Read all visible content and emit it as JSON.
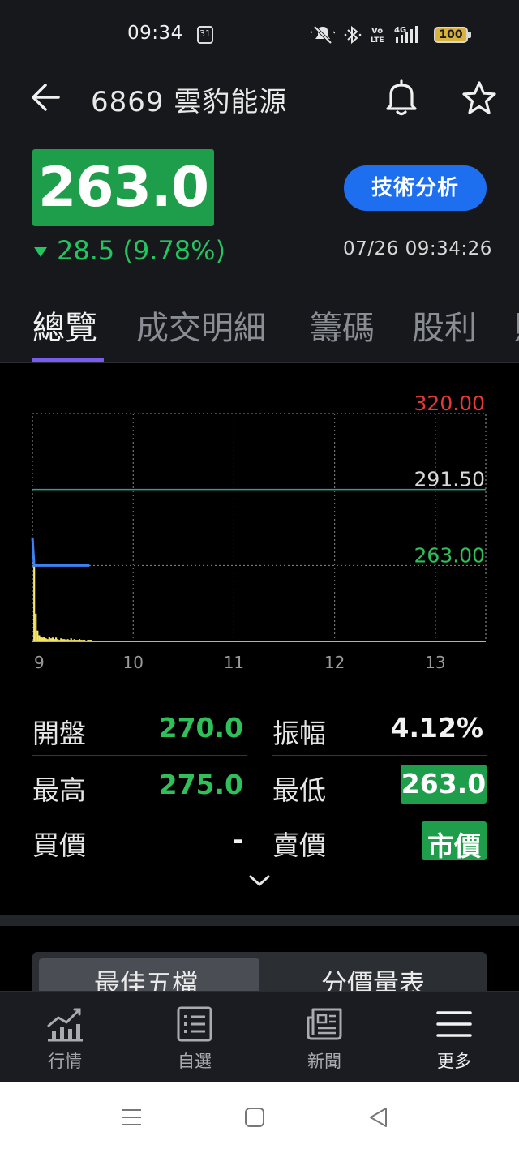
{
  "status_bar": {
    "time": "09:34",
    "calendar_day": "31",
    "battery": "100",
    "icons": [
      "mute-icon",
      "bluetooth-icon",
      "volte-icon",
      "signal-4g-icon",
      "battery-icon"
    ]
  },
  "header": {
    "title": "6869 雲豹能源",
    "icons": [
      "back-arrow-icon",
      "bell-icon",
      "star-icon"
    ]
  },
  "quote": {
    "price": "263.0",
    "change": "28.5 (9.78%)",
    "direction": "down",
    "timestamp": "07/26 09:34:26",
    "tech_button_label": "技術分析",
    "colors": {
      "down": "#22c55e",
      "up": "#e53935",
      "accent": "#1d6ff0"
    }
  },
  "tabs": [
    {
      "label": "總覽",
      "active": true
    },
    {
      "label": "成交明細",
      "active": false
    },
    {
      "label": "籌碼",
      "active": false
    },
    {
      "label": "股利",
      "active": false
    },
    {
      "label": "財",
      "active": false
    }
  ],
  "chart_data": {
    "type": "line",
    "title": "",
    "xlabel": "",
    "ylabel": "",
    "x_ticks": [
      "9",
      "10",
      "11",
      "12",
      "13"
    ],
    "y_labels": [
      {
        "value": 320.0,
        "label": "320.00",
        "color": "#e53935"
      },
      {
        "value": 291.5,
        "label": "291.50",
        "color": "#d8d8d8"
      },
      {
        "value": 263.0,
        "label": "263.00",
        "color": "#2fc05a"
      }
    ],
    "ylim": [
      234.5,
      320.0
    ],
    "xlim": [
      0,
      270
    ],
    "reference_line": 291.5,
    "series": [
      {
        "kind": "price",
        "color": "#3b82f6",
        "x": [
          0,
          1,
          2,
          3,
          4,
          5,
          6,
          8,
          10,
          12,
          14,
          16,
          18,
          20,
          22,
          24,
          26,
          28,
          30,
          32,
          34
        ],
        "y": [
          273.5,
          263.0,
          263.0,
          263.0,
          263.0,
          263.0,
          263.0,
          263.0,
          263.0,
          263.0,
          263.0,
          263.0,
          263.0,
          263.0,
          263.0,
          263.0,
          263.0,
          263.0,
          263.0,
          263.0,
          263.0
        ]
      },
      {
        "kind": "volume",
        "color": "#f5e663",
        "x": [
          1,
          2,
          3,
          4,
          5,
          6,
          7,
          8,
          9,
          10,
          11,
          12,
          13,
          14,
          15,
          16,
          17,
          18,
          19,
          20,
          21,
          22,
          23,
          24,
          25,
          26,
          27,
          28,
          29,
          30,
          31,
          32,
          33,
          34,
          35
        ],
        "values": [
          100,
          36,
          14,
          8,
          6,
          5,
          6,
          4,
          3,
          6,
          4,
          5,
          3,
          5,
          3,
          2,
          4,
          3,
          3,
          2,
          3,
          2,
          4,
          2,
          3,
          2,
          2,
          3,
          2,
          2,
          2,
          1,
          2,
          2,
          2
        ]
      }
    ],
    "grid": true,
    "legend": "none"
  },
  "stats": {
    "open_label": "開盤",
    "open_value": "270.0",
    "amplitude_label": "振幅",
    "amplitude_value": "4.12%",
    "high_label": "最高",
    "high_value": "275.0",
    "low_label": "最低",
    "low_value": "263.0",
    "bid_label": "買價",
    "bid_value": "-",
    "ask_label": "賣價",
    "ask_value": "市價"
  },
  "orderbook_tabs": [
    {
      "label": "最佳五檔",
      "active": true
    },
    {
      "label": "分價量表",
      "active": false
    }
  ],
  "bottom_nav": [
    {
      "label": "行情",
      "icon": "chart-bars-icon",
      "active": false
    },
    {
      "label": "自選",
      "icon": "list-icon",
      "active": false
    },
    {
      "label": "新聞",
      "icon": "newspaper-icon",
      "active": false
    },
    {
      "label": "更多",
      "icon": "menu-icon",
      "active": true
    }
  ],
  "system_nav": [
    "recent-apps-icon",
    "home-icon",
    "back-icon"
  ]
}
